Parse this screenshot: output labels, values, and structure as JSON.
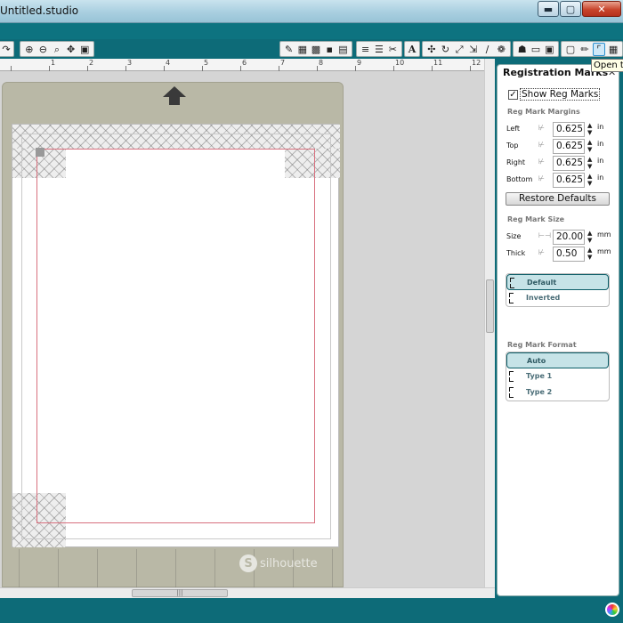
{
  "window": {
    "title": "Untitled.studio",
    "min_label": "▬",
    "max_label": "▢",
    "close_label": "✕"
  },
  "toolbar": {
    "left_icons": [
      "undo-redo-icon"
    ],
    "zoom_icons": [
      "zoom-in-icon",
      "zoom-out-icon",
      "zoom-box-icon",
      "pan-icon",
      "fit-page-icon"
    ],
    "tooltip": "Open th"
  },
  "ruler": {
    "labels": [
      "1",
      "2",
      "3",
      "4",
      "5",
      "6",
      "7",
      "8",
      "9",
      "10",
      "11",
      "12"
    ]
  },
  "mat": {
    "brand": "silhouette",
    "brand_glyph": "S"
  },
  "scroll": {
    "hgrip": "|||"
  },
  "panel": {
    "title": "Registration Marks",
    "close_label": "✕",
    "show_reg_marks": {
      "label": "Show Reg Marks",
      "checked": true,
      "mark": "✓"
    },
    "margins_heading": "Reg Mark Margins",
    "margins": [
      {
        "label": "Left",
        "value": "0.625",
        "unit": "in"
      },
      {
        "label": "Top",
        "value": "0.625",
        "unit": "in"
      },
      {
        "label": "Right",
        "value": "0.625",
        "unit": "in"
      },
      {
        "label": "Bottom",
        "value": "0.625",
        "unit": "in"
      }
    ],
    "restore_label": "Restore Defaults",
    "size_heading": "Reg Mark Size",
    "size": [
      {
        "label": "Size",
        "value": "20.00",
        "unit": "mm"
      },
      {
        "label": "Thick",
        "value": "0.50",
        "unit": "mm"
      }
    ],
    "style_options": [
      {
        "label": "Default",
        "selected": true
      },
      {
        "label": "Inverted",
        "selected": false
      }
    ],
    "format_heading": "Reg Mark Format",
    "format_options": [
      {
        "label": "Auto",
        "selected": true
      },
      {
        "label": "Type 1",
        "selected": false
      },
      {
        "label": "Type 2",
        "selected": false
      }
    ],
    "spin_glyph": "▲▼"
  },
  "colors": {
    "app_teal": "#0d6b78",
    "reg_line": "#d8707e",
    "mat": "#b9b8a6",
    "selected_option": "#c6e3e7"
  }
}
